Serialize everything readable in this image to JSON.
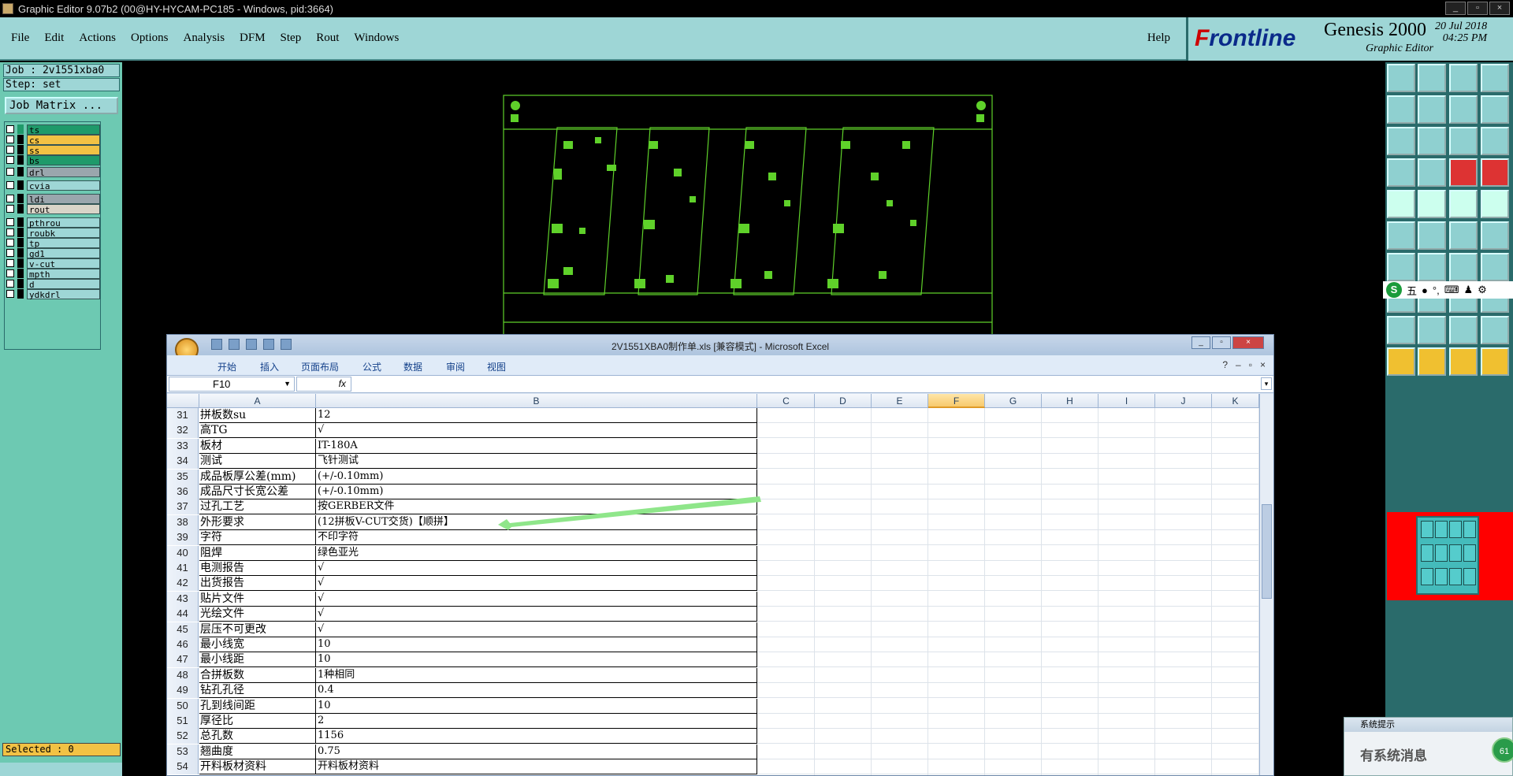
{
  "window": {
    "title": "Graphic Editor 9.07b2 (00@HY-HYCAM-PC185 - Windows, pid:3664)"
  },
  "menu": [
    "File",
    "Edit",
    "Actions",
    "Options",
    "Analysis",
    "DFM",
    "Step",
    "Rout",
    "Windows"
  ],
  "help": "Help",
  "brand": {
    "logo_prefix": "F",
    "logo_rest": "rontline",
    "product": "Genesis 2000",
    "subtitle": "Graphic Editor",
    "date": "20 Jul 2018",
    "time": "04:25 PM"
  },
  "job": {
    "job_label": "Job : 2v1551xba0",
    "step_label": "Step: set",
    "matrix_button": "Job Matrix ..."
  },
  "layers": [
    {
      "name": "ts",
      "color": "#1f9a6a",
      "swatch": "#1f9a6a"
    },
    {
      "name": "cs",
      "color": "#f2c244",
      "swatch": "#000"
    },
    {
      "name": "ss",
      "color": "#f2c244",
      "swatch": "#000"
    },
    {
      "name": "bs",
      "color": "#1f9a6a",
      "swatch": "#000"
    },
    {
      "name": "drl",
      "color": "#9aa6ad",
      "swatch": "#000"
    },
    {
      "name": "cvia",
      "color": "#9ed6d6",
      "swatch": "#000"
    },
    {
      "name": "ldi",
      "color": "#9aa6ad",
      "swatch": "#000"
    },
    {
      "name": "rout",
      "color": "#d9d4c8",
      "swatch": "#000"
    },
    {
      "name": "pthrou",
      "color": "#9ed6d6",
      "swatch": "#000"
    },
    {
      "name": "roubk",
      "color": "#9ed6d6",
      "swatch": "#000"
    },
    {
      "name": "tp",
      "color": "#9ed6d6",
      "swatch": "#000"
    },
    {
      "name": "gd1",
      "color": "#9ed6d6",
      "swatch": "#000"
    },
    {
      "name": "v-cut",
      "color": "#9ed6d6",
      "swatch": "#000"
    },
    {
      "name": "mpth",
      "color": "#9ed6d6",
      "swatch": "#000"
    },
    {
      "name": "d",
      "color": "#9ed6d6",
      "swatch": "#000"
    },
    {
      "name": "ydkdrl",
      "color": "#9ed6d6",
      "swatch": "#000"
    }
  ],
  "selected": "Selected : 0",
  "ime": {
    "label": "五"
  },
  "sysnote": {
    "title": "系统提示",
    "body": "有系统消息",
    "badge": "61"
  },
  "excel": {
    "title": "2V1551XBA0制作单.xls [兼容模式] - Microsoft Excel",
    "tabs": [
      "开始",
      "插入",
      "页面布局",
      "公式",
      "数据",
      "审阅",
      "视图"
    ],
    "namebox": "F10",
    "fx": "fx",
    "columns": [
      "A",
      "B",
      "C",
      "D",
      "E",
      "F",
      "G",
      "H",
      "I",
      "J",
      "K"
    ],
    "selected_column": "F",
    "rows": [
      {
        "n": "31",
        "a": "拼板数su",
        "b": "12"
      },
      {
        "n": "32",
        "a": "高TG",
        "b": "√"
      },
      {
        "n": "33",
        "a": "板材",
        "b": "IT-180A"
      },
      {
        "n": "34",
        "a": "测试",
        "b": "飞针测试"
      },
      {
        "n": "35",
        "a": "成品板厚公差(mm)",
        "b": "(+/-0.10mm)"
      },
      {
        "n": "36",
        "a": "成品尺寸长宽公差",
        "b": "(+/-0.10mm)"
      },
      {
        "n": "37",
        "a": "过孔工艺",
        "b": "按GERBER文件"
      },
      {
        "n": "38",
        "a": "外形要求",
        "b": "(12拼板V-CUT交货)【顺拼】"
      },
      {
        "n": "39",
        "a": "字符",
        "b": "不印字符"
      },
      {
        "n": "40",
        "a": "阻焊",
        "b": "绿色亚光"
      },
      {
        "n": "41",
        "a": "电测报告",
        "b": "√"
      },
      {
        "n": "42",
        "a": "出货报告",
        "b": "√"
      },
      {
        "n": "43",
        "a": "贴片文件",
        "b": "√"
      },
      {
        "n": "44",
        "a": "光绘文件",
        "b": "√"
      },
      {
        "n": "45",
        "a": "层压不可更改",
        "b": "√"
      },
      {
        "n": "46",
        "a": "最小线宽",
        "b": "10"
      },
      {
        "n": "47",
        "a": "最小线距",
        "b": "10"
      },
      {
        "n": "48",
        "a": "合拼板数",
        "b": "1种相同"
      },
      {
        "n": "49",
        "a": "钻孔孔径",
        "b": "0.4"
      },
      {
        "n": "50",
        "a": "孔到线间距",
        "b": "10"
      },
      {
        "n": "51",
        "a": "厚径比",
        "b": "2"
      },
      {
        "n": "52",
        "a": "总孔数",
        "b": "1156"
      },
      {
        "n": "53",
        "a": "翘曲度",
        "b": "0.75"
      },
      {
        "n": "54",
        "a": "开料板材资料",
        "b": "开料板材资料"
      }
    ]
  },
  "colors": {
    "accent": "#9ed6d6",
    "panel": "#6dc9b2",
    "pcb": "#5fd12a",
    "arrow": "#8fe68a"
  }
}
